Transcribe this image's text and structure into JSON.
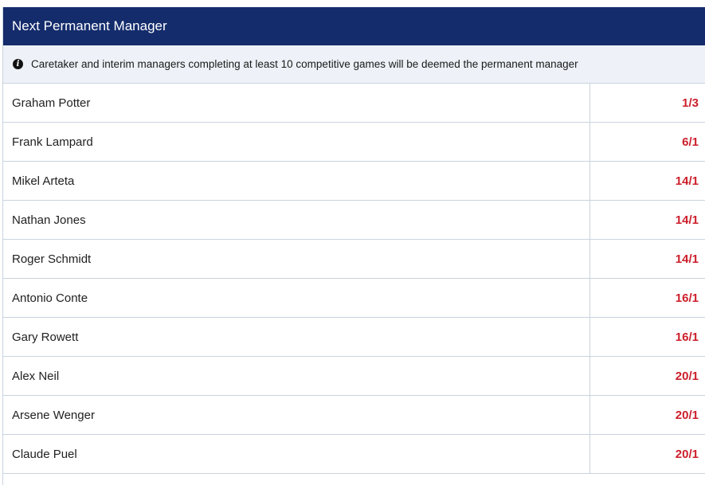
{
  "market": {
    "title": "Next Permanent Manager",
    "info_icon": "info-icon",
    "info_text": "Caretaker and interim managers completing at least 10 competitive games will be deemed the permanent manager",
    "colors": {
      "header_bg": "#142c6c",
      "odds": "#cc1f2b",
      "info_bg": "#eef2f8"
    },
    "selections": [
      {
        "name": "Graham Potter",
        "odds": "1/3"
      },
      {
        "name": "Frank Lampard",
        "odds": "6/1"
      },
      {
        "name": "Mikel Arteta",
        "odds": "14/1"
      },
      {
        "name": "Nathan Jones",
        "odds": "14/1"
      },
      {
        "name": "Roger Schmidt",
        "odds": "14/1"
      },
      {
        "name": "Antonio Conte",
        "odds": "16/1"
      },
      {
        "name": "Gary Rowett",
        "odds": "16/1"
      },
      {
        "name": "Alex Neil",
        "odds": "20/1"
      },
      {
        "name": "Arsene Wenger",
        "odds": "20/1"
      },
      {
        "name": "Claude Puel",
        "odds": "20/1"
      }
    ]
  }
}
